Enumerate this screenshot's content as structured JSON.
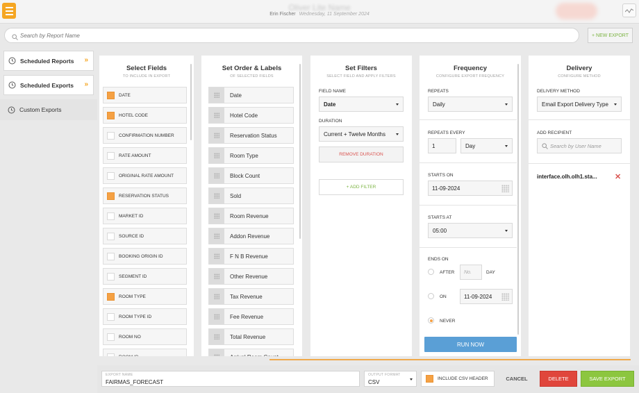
{
  "header": {
    "hotel_name": "Oliver Lite Name",
    "user": "Erin Fischer",
    "date": "Wednesday, 11 September 2024",
    "menu_icon": "hamburger-icon",
    "trend_icon": "trend-icon",
    "accent_color": "#f5a623"
  },
  "search": {
    "placeholder": "Search by Report Name",
    "new_export_label": "+ NEW EXPORT"
  },
  "sidebar": {
    "items": [
      {
        "label": "Scheduled Reports"
      },
      {
        "label": "Scheduled Exports"
      },
      {
        "label": "Custom Exports"
      }
    ]
  },
  "select_fields": {
    "title": "Select Fields",
    "subtitle": "TO INCLUDE IN EXPORT",
    "fields": [
      {
        "label": "DATE",
        "checked": true
      },
      {
        "label": "HOTEL CODE",
        "checked": true
      },
      {
        "label": "CONFIRMATION NUMBER",
        "checked": false
      },
      {
        "label": "RATE AMOUNT",
        "checked": false
      },
      {
        "label": "ORIGINAL RATE AMOUNT",
        "checked": false
      },
      {
        "label": "RESERVATION STATUS",
        "checked": true
      },
      {
        "label": "MARKET ID",
        "checked": false
      },
      {
        "label": "SOURCE ID",
        "checked": false
      },
      {
        "label": "BOOKING ORIGIN ID",
        "checked": false
      },
      {
        "label": "SEGMENT ID",
        "checked": false
      },
      {
        "label": "ROOM TYPE",
        "checked": true
      },
      {
        "label": "ROOM TYPE ID",
        "checked": false
      },
      {
        "label": "ROOM NO",
        "checked": false
      },
      {
        "label": "ROOM ID",
        "checked": false
      }
    ]
  },
  "order_labels": {
    "title": "Set Order & Labels",
    "subtitle": "OF SELECTED FIELDS",
    "items": [
      "Date",
      "Hotel Code",
      "Reservation Status",
      "Room Type",
      "Block Count",
      "Sold",
      "Room Revenue",
      "Addon Revenue",
      "F N B Revenue",
      "Other Revenue",
      "Tax Revenue",
      "Fee Revenue",
      "Total Revenue",
      "Arrival Room Count"
    ]
  },
  "filters": {
    "title": "Set Filters",
    "subtitle": "SELECT FIELD AND APPLY FILTERS",
    "field_name_label": "FIELD NAME",
    "field_name_value": "Date",
    "duration_label": "DURATION",
    "duration_value": "Current + Twelve Months",
    "remove_label": "REMOVE DURATION",
    "add_label": "+ ADD FILTER"
  },
  "frequency": {
    "title": "Frequency",
    "subtitle": "CONFIGURE EXPORT FREQUENCY",
    "repeats_label": "REPEATS",
    "repeats_value": "Daily",
    "every_label": "REPEATS EVERY",
    "every_value": "1",
    "every_unit": "Day",
    "starts_on_label": "STARTS ON",
    "starts_on_value": "11-09-2024",
    "starts_at_label": "STARTS AT",
    "starts_at_value": "05:00",
    "ends_on_label": "ENDS ON",
    "after_label": "AFTER",
    "after_placeholder": "No.",
    "day_label": "DAY",
    "on_label": "ON",
    "on_value": "11-09-2024",
    "never_label": "NEVER",
    "ends_selected": "NEVER",
    "run_now_label": "RUN NOW"
  },
  "delivery": {
    "title": "Delivery",
    "subtitle": "CONFIGURE METHOD",
    "method_label": "DELIVERY METHOD",
    "method_value": "Email Export Delivery Type",
    "recipient_label": "ADD RECIPIENT",
    "recipient_placeholder": "Search by User Name",
    "recipient": "interface.olh.olh1.sta..."
  },
  "footer": {
    "export_name_caption": "EXPORT NAME",
    "export_name": "FAIRMAS_FORECAST",
    "output_format_caption": "OUTPUT FORMAT",
    "output_format": "CSV",
    "include_header_label": "INCLUDE CSV HEADER",
    "include_header_checked": true,
    "cancel_label": "CANCEL",
    "delete_label": "DELETE",
    "save_label": "SAVE EXPORT"
  }
}
